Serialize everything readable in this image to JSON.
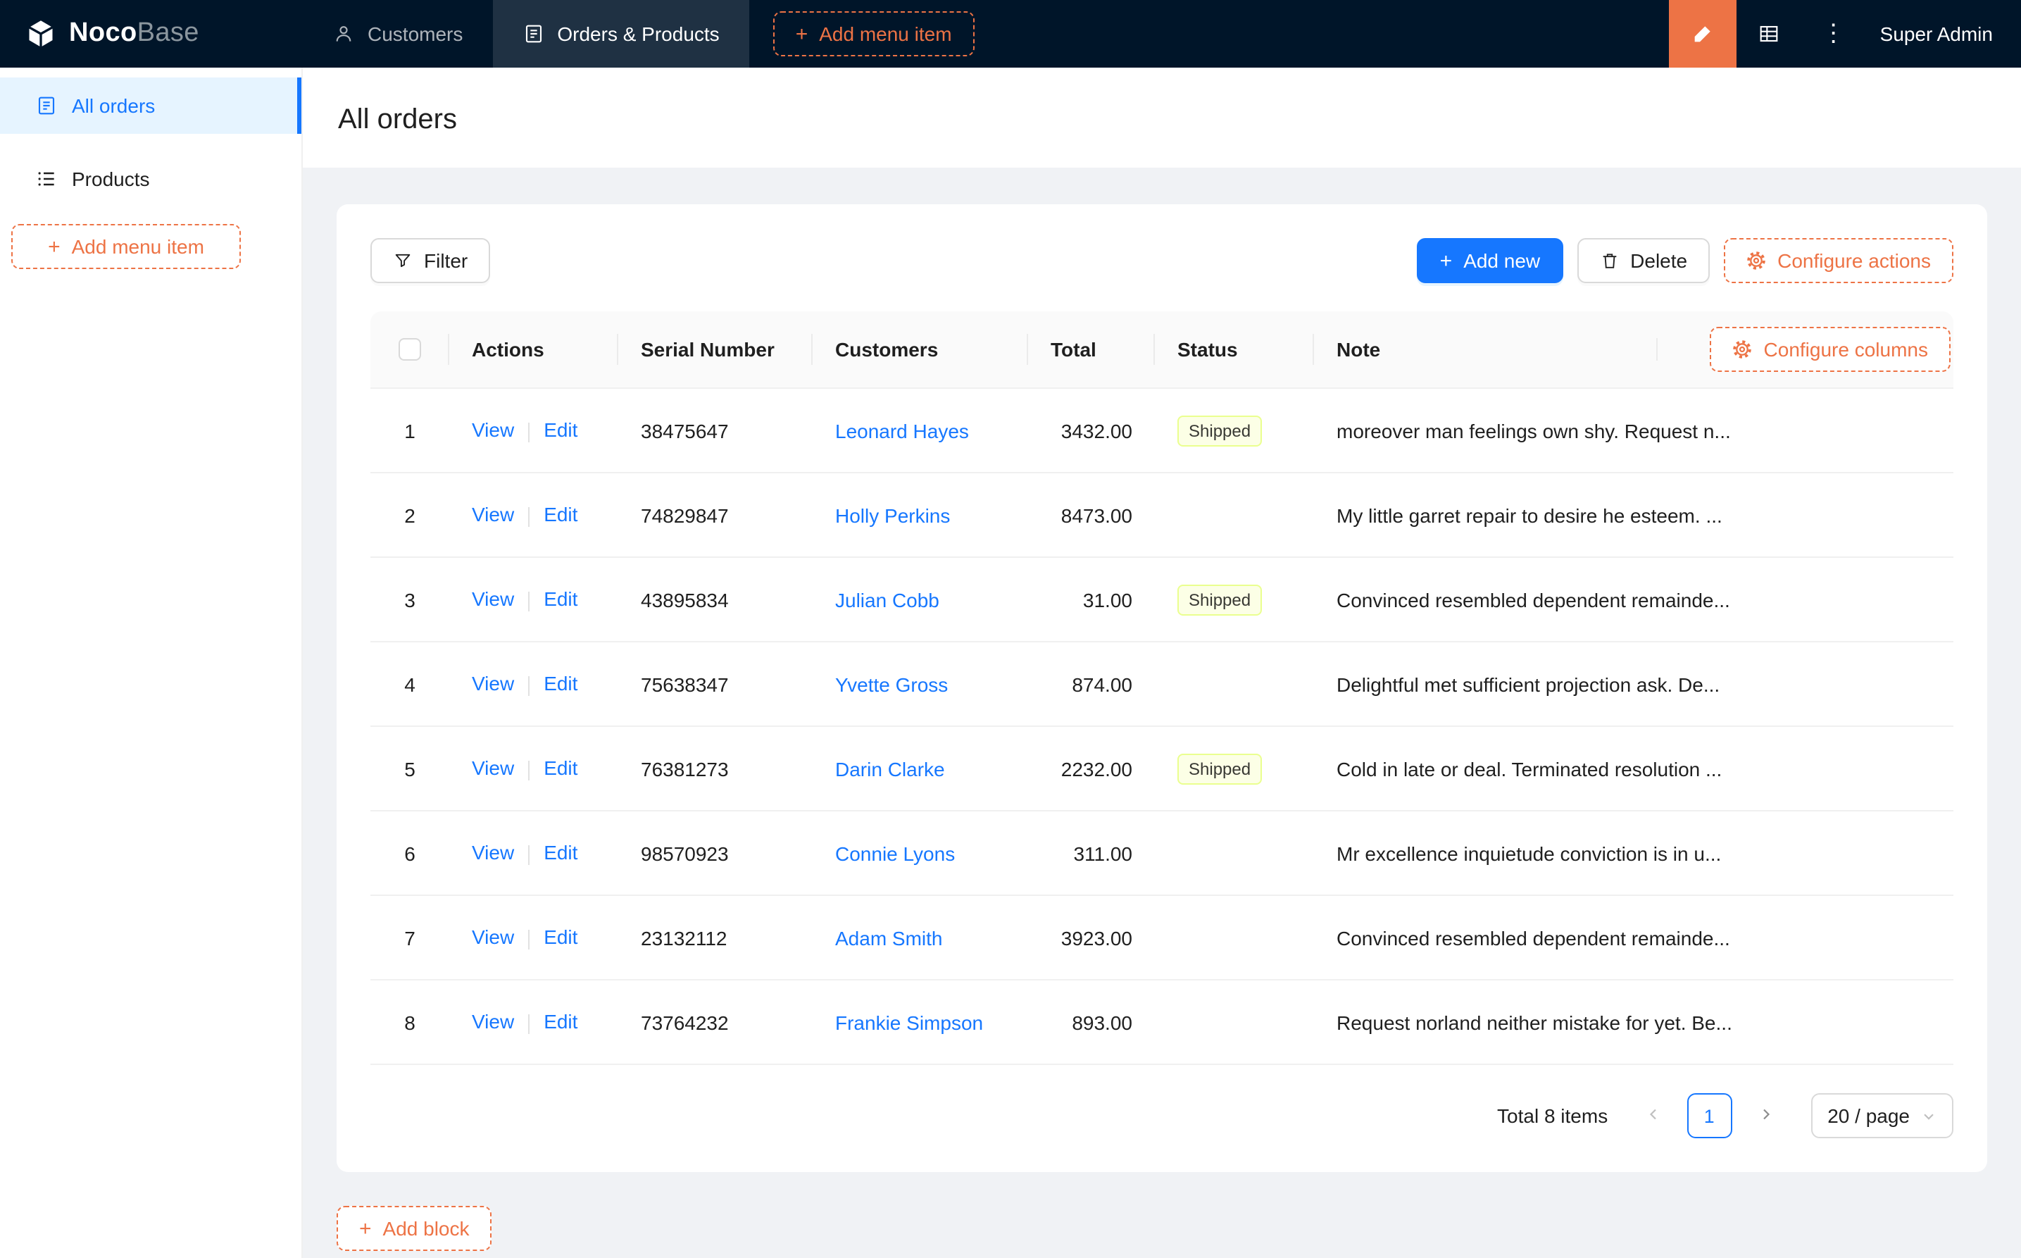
{
  "navbar": {
    "logo_noco": "Noco",
    "logo_base": "Base",
    "items": [
      {
        "label": "Customers",
        "icon": "users-icon",
        "active": false
      },
      {
        "label": "Orders & Products",
        "icon": "form-icon",
        "active": true
      }
    ],
    "add_menu_item": "Add menu item",
    "user": "Super Admin"
  },
  "sidebar": {
    "items": [
      {
        "label": "All orders",
        "icon": "file-table-icon",
        "active": true
      },
      {
        "label": "Products",
        "icon": "list-icon",
        "active": false
      }
    ],
    "add_menu_item": "Add menu item"
  },
  "page": {
    "title": "All orders"
  },
  "toolbar": {
    "filter": "Filter",
    "add_new": "Add new",
    "delete": "Delete",
    "configure_actions": "Configure actions"
  },
  "table": {
    "configure_columns": "Configure columns",
    "columns": [
      "Actions",
      "Serial Number",
      "Customers",
      "Total",
      "Status",
      "Note"
    ],
    "action_labels": {
      "view": "View",
      "edit": "Edit"
    },
    "rows": [
      {
        "index": 1,
        "serial": "38475647",
        "customer": "Leonard Hayes",
        "total": "3432.00",
        "status": "Shipped",
        "note": "moreover man feelings own shy. Request n..."
      },
      {
        "index": 2,
        "serial": "74829847",
        "customer": "Holly Perkins",
        "total": "8473.00",
        "status": "",
        "note": "My little garret repair to desire he esteem. ..."
      },
      {
        "index": 3,
        "serial": "43895834",
        "customer": "Julian Cobb",
        "total": "31.00",
        "status": "Shipped",
        "note": "Convinced resembled dependent remainde..."
      },
      {
        "index": 4,
        "serial": "75638347",
        "customer": "Yvette Gross",
        "total": "874.00",
        "status": "",
        "note": "Delightful met sufficient projection ask. De..."
      },
      {
        "index": 5,
        "serial": "76381273",
        "customer": "Darin Clarke",
        "total": "2232.00",
        "status": "Shipped",
        "note": "Cold in late or deal. Terminated resolution ..."
      },
      {
        "index": 6,
        "serial": "98570923",
        "customer": "Connie Lyons",
        "total": "311.00",
        "status": "",
        "note": "Mr excellence inquietude conviction is in u..."
      },
      {
        "index": 7,
        "serial": "23132112",
        "customer": "Adam Smith",
        "total": "3923.00",
        "status": "",
        "note": "Convinced resembled dependent remainde..."
      },
      {
        "index": 8,
        "serial": "73764232",
        "customer": "Frankie Simpson",
        "total": "893.00",
        "status": "",
        "note": "Request norland neither mistake for yet. Be..."
      }
    ]
  },
  "pagination": {
    "total_text": "Total 8 items",
    "current_page": "1",
    "page_size": "20 / page"
  },
  "footer": {
    "add_block": "Add block"
  },
  "glyphs": {
    "plus": "+",
    "ellipsis": "⋮"
  },
  "colors": {
    "primary": "#1677ff",
    "designer_orange": "#ed7345",
    "navbar_bg": "#001529",
    "active_item_bg": "#e6f4ff",
    "status_tag_bg": "#fcffe6",
    "status_tag_border": "#eaff8f",
    "content_bg": "#f0f2f5"
  }
}
